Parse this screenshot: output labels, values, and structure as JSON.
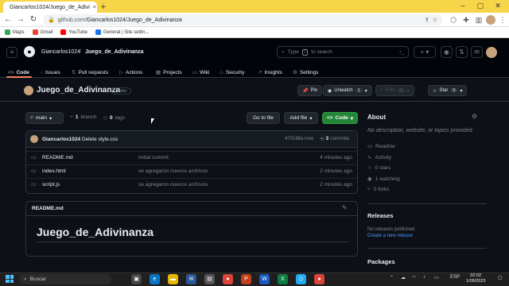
{
  "browser": {
    "tab_title": "Giancarlos1024/Juego_de_Adivi",
    "tab_close": "×",
    "new_tab": "+",
    "url_domain": "github.com/",
    "url_path": "Giancarlos1024/Juego_de_Adivinanza",
    "bookmarks": [
      {
        "label": "Maps",
        "color": "#34a853"
      },
      {
        "label": "Gmail",
        "color": "#ea4335"
      },
      {
        "label": "YouTube",
        "color": "#ff0000"
      },
      {
        "label": "General | Site settin...",
        "color": "#1a73e8"
      }
    ]
  },
  "gh": {
    "owner": "Giancarlos1024",
    "separator": "/",
    "repo": "Juego_de_Adivinanza",
    "search_placeholder": "Type",
    "search_kbd": "/",
    "search_suffix": "to search",
    "tabs": [
      {
        "label": "Code",
        "icon": "<>"
      },
      {
        "label": "Issues",
        "icon": "○"
      },
      {
        "label": "Pull requests",
        "icon": "⇅"
      },
      {
        "label": "Actions",
        "icon": "▷"
      },
      {
        "label": "Projects",
        "icon": "▦"
      },
      {
        "label": "Wiki",
        "icon": "▭"
      },
      {
        "label": "Security",
        "icon": "◇"
      },
      {
        "label": "Insights",
        "icon": "↗"
      },
      {
        "label": "Settings",
        "icon": "⚙"
      }
    ]
  },
  "repo": {
    "name": "Juego_de_Adivinanza",
    "visibility": "Public",
    "pin": "Pin",
    "unwatch": "Unwatch",
    "unwatch_count": "1",
    "fork": "Fork",
    "fork_count": "0",
    "star": "Star",
    "star_count": "0"
  },
  "branchbar": {
    "branch": "main",
    "branches_count": "1",
    "branches_label": "branch",
    "tags_count": "0",
    "tags_label": "tags",
    "go_to_file": "Go to file",
    "add_file": "Add file",
    "code": "Code"
  },
  "commit": {
    "author": "Giancarlos1024",
    "message": "Delete style.css",
    "hash": "473198a",
    "time": "now",
    "count": "3",
    "count_label": "commits"
  },
  "files": [
    {
      "name": "README.md",
      "message": "Initial commit",
      "date": "4 minutes ago"
    },
    {
      "name": "index.html",
      "message": "se agregaron nuevos archivos",
      "date": "2 minutes ago"
    },
    {
      "name": "script.js",
      "message": "se agregaron nuevos archivos",
      "date": "2 minutes ago"
    }
  ],
  "readme": {
    "label": "README.md",
    "title": "Juego_de_Adivinanza"
  },
  "about": {
    "title": "About",
    "description": "No description, website, or topics provided.",
    "items": [
      "Readme",
      "Activity",
      "0 stars",
      "1 watching",
      "0 forks"
    ],
    "releases_title": "Releases",
    "releases_text": "No releases published",
    "releases_link": "Create a new release",
    "packages_title": "Packages"
  },
  "taskbar": {
    "search": "Buscar",
    "lang": "ESP",
    "time": "02:02",
    "date": "1/09/2023"
  }
}
